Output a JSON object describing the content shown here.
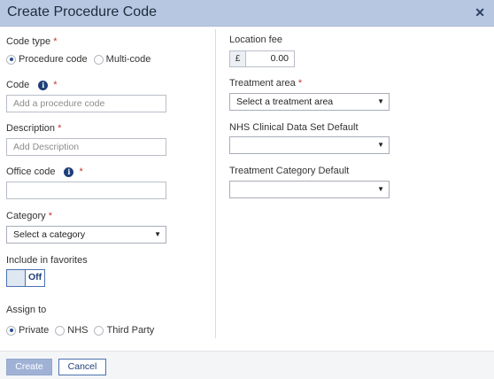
{
  "dialog": {
    "title": "Create Procedure Code",
    "close_glyph": "✕"
  },
  "left": {
    "code_type": {
      "label": "Code type",
      "required": "*",
      "options": [
        "Procedure code",
        "Multi-code"
      ],
      "selected": "Procedure code"
    },
    "code": {
      "label": "Code",
      "info": "i",
      "required": "*",
      "placeholder": "Add a procedure code"
    },
    "description": {
      "label": "Description",
      "required": "*",
      "placeholder": "Add Description"
    },
    "office_code": {
      "label": "Office code",
      "info": "i",
      "required": "*",
      "value": ""
    },
    "category": {
      "label": "Category",
      "required": "*",
      "value": "Select a category"
    },
    "favorites": {
      "label": "Include in favorites",
      "state": "Off"
    },
    "assign_to": {
      "label": "Assign to",
      "options": [
        "Private",
        "NHS",
        "Third Party"
      ],
      "selected": "Private"
    }
  },
  "right": {
    "location_fee": {
      "label": "Location fee",
      "currency": "£",
      "value": "0.00"
    },
    "treatment_area": {
      "label": "Treatment area",
      "required": "*",
      "value": "Select a treatment area"
    },
    "nhs_default": {
      "label": "NHS Clinical Data Set Default",
      "value": ""
    },
    "category_default": {
      "label": "Treatment Category Default",
      "value": ""
    }
  },
  "footer": {
    "create_label": "Create",
    "cancel_label": "Cancel"
  },
  "icons": {
    "close": "close-icon",
    "info": "info-icon",
    "dropdown": "chevron-down-icon"
  },
  "colors": {
    "titlebar": "#b7c7e1",
    "accent": "#2a4f8f",
    "required": "#c0392b",
    "create_button": "#9fb2d6"
  }
}
